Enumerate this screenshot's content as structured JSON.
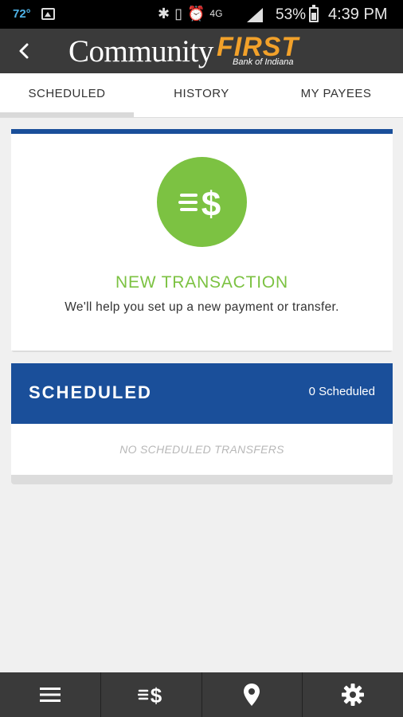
{
  "status_bar": {
    "temperature": "72°",
    "battery_percent": "53%",
    "time": "4:39 PM",
    "icons": [
      "image-icon",
      "bluetooth-icon",
      "vibrate-icon",
      "alarm-icon",
      "4g-lte-icon",
      "signal-icon",
      "battery-icon"
    ]
  },
  "header": {
    "logo_main": "Community",
    "logo_accent": "FIRST",
    "logo_sub": "Bank of Indiana"
  },
  "tabs": [
    {
      "label": "SCHEDULED",
      "active": true
    },
    {
      "label": "HISTORY",
      "active": false
    },
    {
      "label": "MY PAYEES",
      "active": false
    }
  ],
  "new_transaction": {
    "title": "NEW TRANSACTION",
    "subtitle": "We'll help you set up a new payment or transfer."
  },
  "scheduled": {
    "title": "SCHEDULED",
    "count_label": "0 Scheduled",
    "empty_message": "NO SCHEDULED TRANSFERS"
  },
  "bottom_nav": [
    {
      "icon": "menu-icon"
    },
    {
      "icon": "transfer-dollar-icon"
    },
    {
      "icon": "location-pin-icon"
    },
    {
      "icon": "gear-icon"
    }
  ],
  "colors": {
    "brand_blue": "#1a4f9a",
    "accent_green": "#7cc242",
    "accent_orange": "#f2a12a",
    "bar_dark": "#3a3a3a"
  }
}
